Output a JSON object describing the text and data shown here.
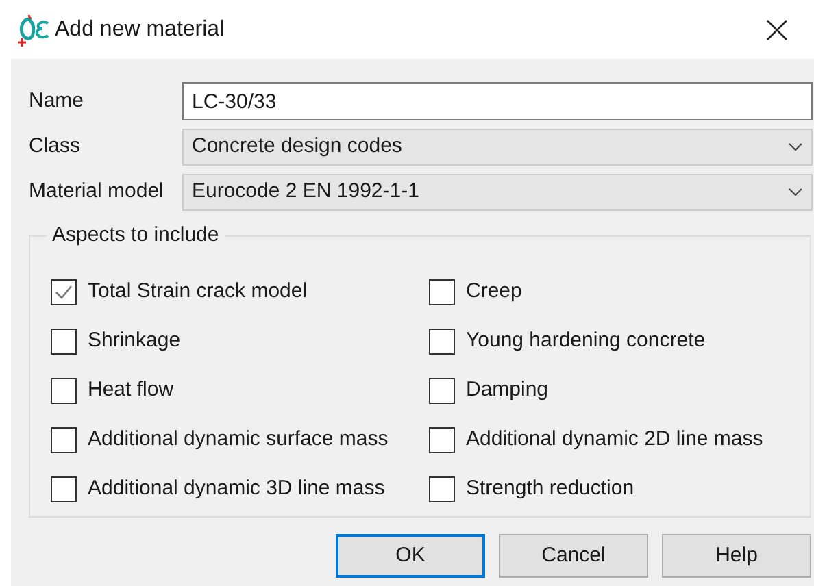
{
  "window": {
    "title": "Add new material"
  },
  "fields": [
    {
      "kind": "text",
      "label": "Name",
      "value": "LC-30/33"
    },
    {
      "kind": "select",
      "label": "Class",
      "value": "Concrete design codes"
    },
    {
      "kind": "select",
      "label": "Material model",
      "value": "Eurocode 2 EN 1992-1-1"
    }
  ],
  "aspects": {
    "title": "Aspects to include",
    "items": [
      {
        "label": "Total Strain crack model",
        "checked": true
      },
      {
        "label": "Creep",
        "checked": false
      },
      {
        "label": "Shrinkage",
        "checked": false
      },
      {
        "label": "Young hardening concrete",
        "checked": false
      },
      {
        "label": "Heat flow",
        "checked": false
      },
      {
        "label": "Damping",
        "checked": false
      },
      {
        "label": "Additional dynamic surface mass",
        "checked": false
      },
      {
        "label": "Additional dynamic 2D line mass",
        "checked": false
      },
      {
        "label": "Additional dynamic 3D line mass",
        "checked": false
      },
      {
        "label": "Strength reduction",
        "checked": false
      }
    ]
  },
  "buttons": [
    {
      "label": "OK",
      "default": true
    },
    {
      "label": "Cancel",
      "default": false
    },
    {
      "label": "Help",
      "default": false
    }
  ]
}
